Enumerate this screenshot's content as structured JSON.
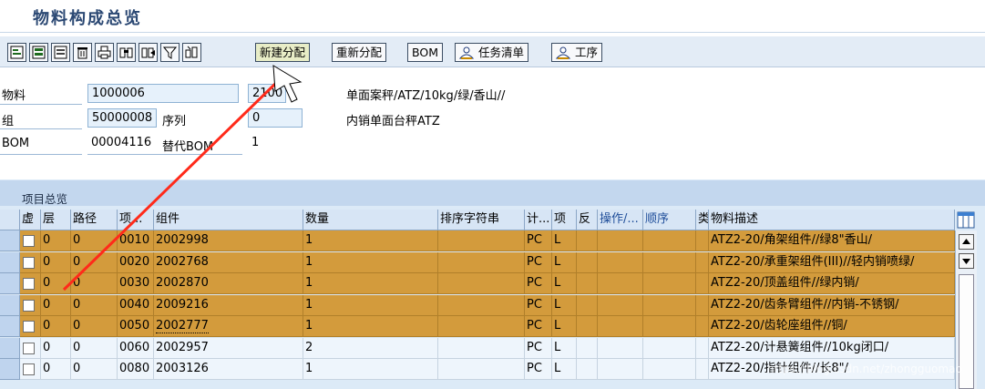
{
  "window_title": "物料构成总览",
  "toolbar": {
    "icons": [
      "detail-icon",
      "select-icon",
      "deselect-icon",
      "delete-icon",
      "print-icon",
      "find-icon",
      "find-next-icon",
      "filter-icon",
      "sort-icon"
    ],
    "buttons": {
      "new_assign": "新建分配",
      "reassign": "重新分配",
      "bom": "BOM",
      "task_list": "任务清单",
      "operation": "工序"
    }
  },
  "header": {
    "material_label": "物料",
    "material_value": "1000006",
    "plant_value": "2100",
    "material_desc": "单面案秤/ATZ/10kg/绿/香山//",
    "group_label": "组",
    "group_value": "50000008",
    "seq_label": "序列",
    "seq_value": "0",
    "group_desc": "内销单面台秤ATZ",
    "bom_label": "BOM",
    "bom_value": "00004116",
    "alt_bom_label": "替代BOM",
    "alt_bom_value": "1"
  },
  "section_title": "项目总览",
  "table": {
    "columns": [
      "虚",
      "层",
      "路径",
      "项...",
      "组件",
      "数量",
      "排序字符串",
      "计...",
      "项",
      "反",
      "操作/...",
      "顺序",
      "类",
      "物料描述"
    ],
    "rows": [
      {
        "level": "0",
        "path": "0",
        "item": "0010",
        "component": "2002998",
        "qty": "1",
        "unit": "PC",
        "cat": "L",
        "desc": "ATZ2-20/角架组件//绿8\"香山/",
        "selected": true
      },
      {
        "level": "0",
        "path": "0",
        "item": "0020",
        "component": "2002768",
        "qty": "1",
        "unit": "PC",
        "cat": "L",
        "desc": "ATZ2-20/承重架组件(III)//轻内销喷绿/",
        "selected": true
      },
      {
        "level": "0",
        "path": "0",
        "item": "0030",
        "component": "2002870",
        "qty": "1",
        "unit": "PC",
        "cat": "L",
        "desc": "ATZ2-20/顶盖组件//绿内销/",
        "selected": true
      },
      {
        "level": "0",
        "path": "0",
        "item": "0040",
        "component": "2009216",
        "qty": "1",
        "unit": "PC",
        "cat": "L",
        "desc": "ATZ2-20/齿条臂组件//内销-不锈钢/",
        "selected": true
      },
      {
        "level": "0",
        "path": "0",
        "item": "0050",
        "component": "2002777",
        "qty": "1",
        "unit": "PC",
        "cat": "L",
        "desc": "ATZ2-20/齿轮座组件//铜/",
        "selected": true
      },
      {
        "level": "0",
        "path": "0",
        "item": "0060",
        "component": "2002957",
        "qty": "2",
        "unit": "PC",
        "cat": "L",
        "desc": "ATZ2-20/计悬簧组件//10kg闭口/",
        "selected": false
      },
      {
        "level": "0",
        "path": "0",
        "item": "0080",
        "component": "2003126",
        "qty": "1",
        "unit": "PC",
        "cat": "L",
        "desc": "ATZ2-20/指针组件//长8\"/",
        "selected": false
      }
    ]
  },
  "watermark": "https://blog.csdn.net/zhongguomao",
  "colors": {
    "selected_row": "#d39b3c",
    "toolbar_bg": "#e3ecf6",
    "title_text": "#2b4873",
    "arrow": "#ff2a1a"
  }
}
